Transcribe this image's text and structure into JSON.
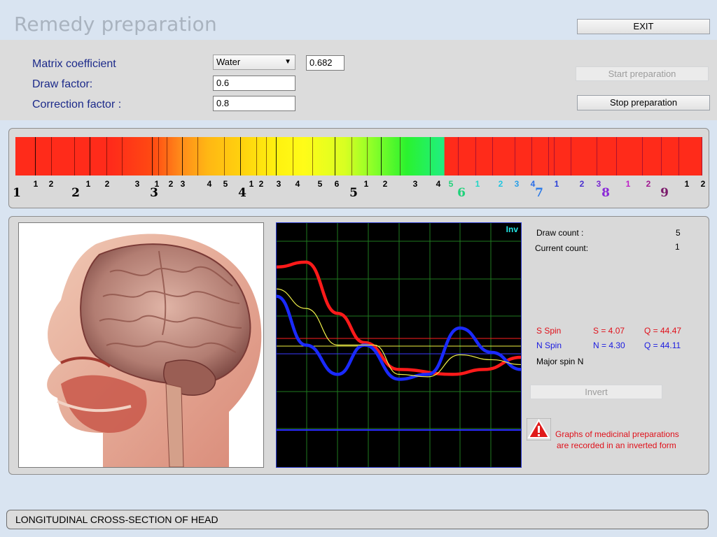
{
  "window": {
    "title": "Remedy preparation"
  },
  "buttons": {
    "exit": "EXIT",
    "start": "Start preparation",
    "stop": "Stop preparation",
    "invert": "Invert"
  },
  "params": {
    "matrix_label": "Matrix coefficient",
    "matrix_selected": "Water",
    "matrix_value": "0.682",
    "draw_label": "Draw factor:",
    "draw_value": "0.6",
    "correction_label": "Correction factor :",
    "correction_value": "0.8"
  },
  "spectrum": {
    "small_labels": [
      {
        "t": "1",
        "c": "#000"
      },
      {
        "t": "2",
        "c": "#000"
      },
      {
        "t": "1",
        "c": "#000"
      },
      {
        "t": "2",
        "c": "#000"
      },
      {
        "t": "3",
        "c": "#000"
      },
      {
        "t": "1",
        "c": "#000"
      },
      {
        "t": "2",
        "c": "#000"
      },
      {
        "t": "3",
        "c": "#000"
      },
      {
        "t": "4",
        "c": "#000"
      },
      {
        "t": "5",
        "c": "#000"
      },
      {
        "t": "1",
        "c": "#000"
      },
      {
        "t": "2",
        "c": "#000"
      },
      {
        "t": "3",
        "c": "#000"
      },
      {
        "t": "4",
        "c": "#000"
      },
      {
        "t": "5",
        "c": "#000"
      },
      {
        "t": "6",
        "c": "#000"
      },
      {
        "t": "1",
        "c": "#000"
      },
      {
        "t": "2",
        "c": "#000"
      },
      {
        "t": "3",
        "c": "#000"
      },
      {
        "t": "4",
        "c": "#000"
      },
      {
        "t": "5",
        "c": "#22d27a"
      },
      {
        "t": "1",
        "c": "#22d6c6"
      },
      {
        "t": "2",
        "c": "#20c6e0"
      },
      {
        "t": "3",
        "c": "#2aa0e8"
      },
      {
        "t": "4",
        "c": "#2a6ee8"
      },
      {
        "t": "1",
        "c": "#2a40d8"
      },
      {
        "t": "2",
        "c": "#4a30d0"
      },
      {
        "t": "3",
        "c": "#7a28d0"
      },
      {
        "t": "1",
        "c": "#c020c8"
      },
      {
        "t": "2",
        "c": "#a01890"
      },
      {
        "t": "1",
        "c": "#000"
      },
      {
        "t": "2",
        "c": "#000"
      }
    ],
    "big_labels": [
      {
        "t": "1",
        "c": "#000"
      },
      {
        "t": "2",
        "c": "#000"
      },
      {
        "t": "3",
        "c": "#000"
      },
      {
        "t": "4",
        "c": "#000"
      },
      {
        "t": "5",
        "c": "#000"
      },
      {
        "t": "6",
        "c": "#1ed27a"
      },
      {
        "t": "7",
        "c": "#2a7ae8"
      },
      {
        "t": "8",
        "c": "#8a28d8"
      },
      {
        "t": "9",
        "c": "#7a1a6a"
      }
    ]
  },
  "graph": {
    "overlay_label": "Inv",
    "grid_color": "#1f7a1f",
    "series": [
      {
        "color": "#ff1a1a",
        "points": [
          [
            0,
            0.18
          ],
          [
            0.12,
            0.16
          ],
          [
            0.25,
            0.37
          ],
          [
            0.36,
            0.49
          ],
          [
            0.5,
            0.6
          ],
          [
            0.72,
            0.62
          ],
          [
            0.85,
            0.6
          ],
          [
            1,
            0.55
          ]
        ]
      },
      {
        "color": "#1a2aff",
        "points": [
          [
            0,
            0.3
          ],
          [
            0.12,
            0.5
          ],
          [
            0.25,
            0.62
          ],
          [
            0.36,
            0.5
          ],
          [
            0.5,
            0.64
          ],
          [
            0.62,
            0.62
          ],
          [
            0.75,
            0.43
          ],
          [
            0.88,
            0.53
          ],
          [
            1,
            0.6
          ]
        ]
      },
      {
        "color": "#f3f34a",
        "points": [
          [
            0,
            0.27
          ],
          [
            0.12,
            0.35
          ],
          [
            0.25,
            0.5
          ],
          [
            0.4,
            0.5
          ],
          [
            0.5,
            0.62
          ],
          [
            0.62,
            0.63
          ],
          [
            0.75,
            0.54
          ],
          [
            0.88,
            0.56
          ],
          [
            1,
            0.58
          ]
        ]
      }
    ]
  },
  "info": {
    "draw_count_label": "Draw count :",
    "draw_count": "5",
    "current_count_label": "Current count:",
    "current_count": "1",
    "s_spin_label": "S Spin",
    "s_value": "S = 4.07",
    "s_q": "Q = 44.47",
    "n_spin_label": "N Spin",
    "n_value": "N = 4.30",
    "n_q": "Q = 44.11",
    "major_spin": "Major spin N"
  },
  "warning": {
    "line1": "Graphs of medicinal preparations",
    "line2": "are recorded in an inverted form"
  },
  "status": {
    "text": "LONGITUDINAL CROSS-SECTION OF HEAD"
  },
  "colors": {
    "accent_label": "#1c2a8a",
    "s_spin": "#e0101a",
    "n_spin": "#1a1ae0"
  }
}
